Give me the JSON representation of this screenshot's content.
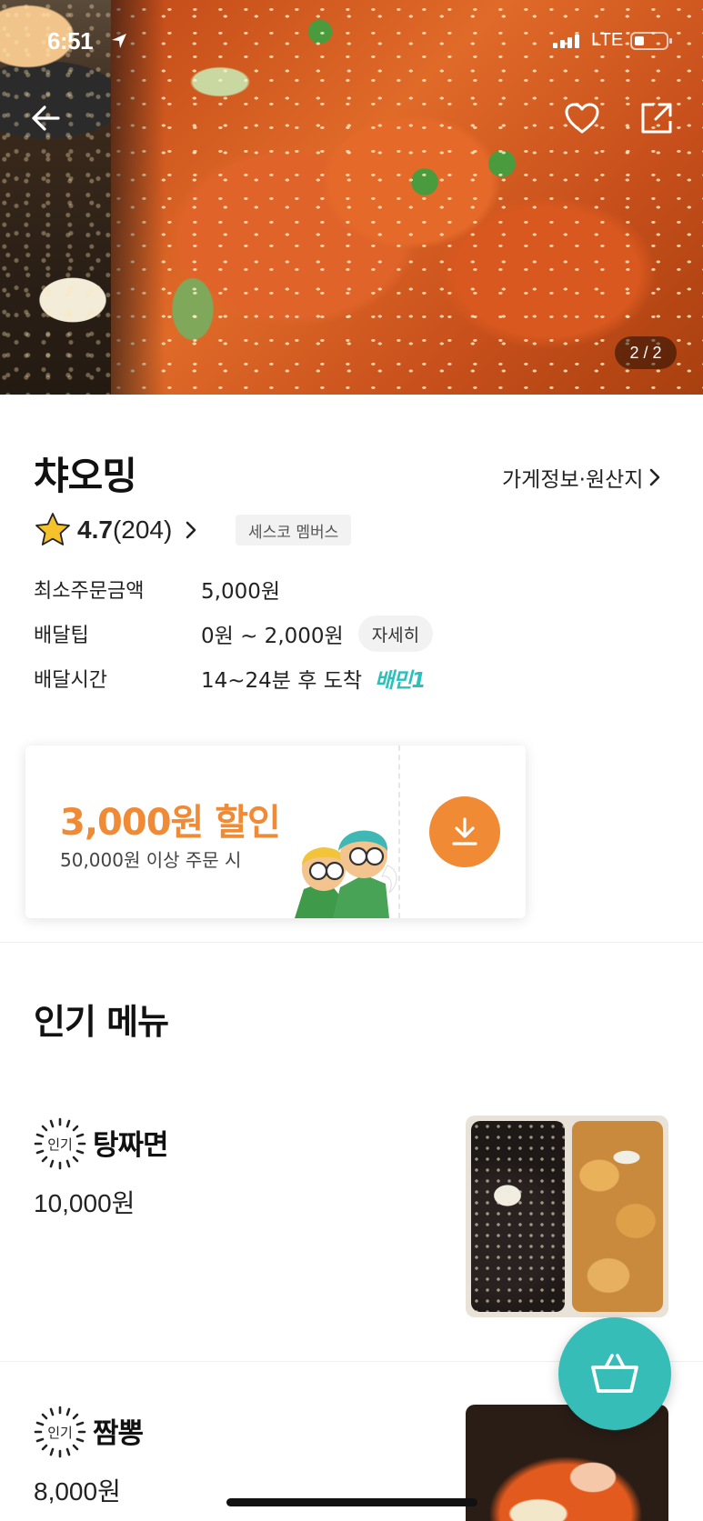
{
  "status_bar": {
    "time": "6:51",
    "network": "LTE"
  },
  "gallery": {
    "page_indicator": "2 / 2",
    "current_page": 2,
    "total_pages": 2
  },
  "store": {
    "name": "챠오밍",
    "info_link": "가게정보·원산지",
    "rating": "4.7",
    "review_count": "(204)",
    "badge": "세스코 멤버스"
  },
  "info": {
    "rows": [
      {
        "label": "최소주문금액",
        "value": "5,000원"
      },
      {
        "label": "배달팁",
        "value": "0원 ~ 2,000원",
        "action": "자세히"
      },
      {
        "label": "배달시간",
        "value": "14~24분 후 도착",
        "badge": "배민1"
      }
    ]
  },
  "coupon": {
    "title": "3,000원 할인",
    "subtitle": "50,000원 이상 주문 시",
    "accent": "#f08a34"
  },
  "popular": {
    "title": "인기 메뉴",
    "badge_label": "인기",
    "items": [
      {
        "name": "탕짜면",
        "price": "10,000원"
      },
      {
        "name": "짬뽕",
        "price": "8,000원"
      }
    ]
  },
  "colors": {
    "mint": "#36bdb8",
    "orange": "#f08a34",
    "baemin1_teal": "#2ac1bc"
  },
  "icons": [
    "back-arrow-icon",
    "heart-icon",
    "share-icon",
    "star-icon",
    "chevron-right-icon",
    "download-icon",
    "basket-icon",
    "location-arrow-icon"
  ]
}
